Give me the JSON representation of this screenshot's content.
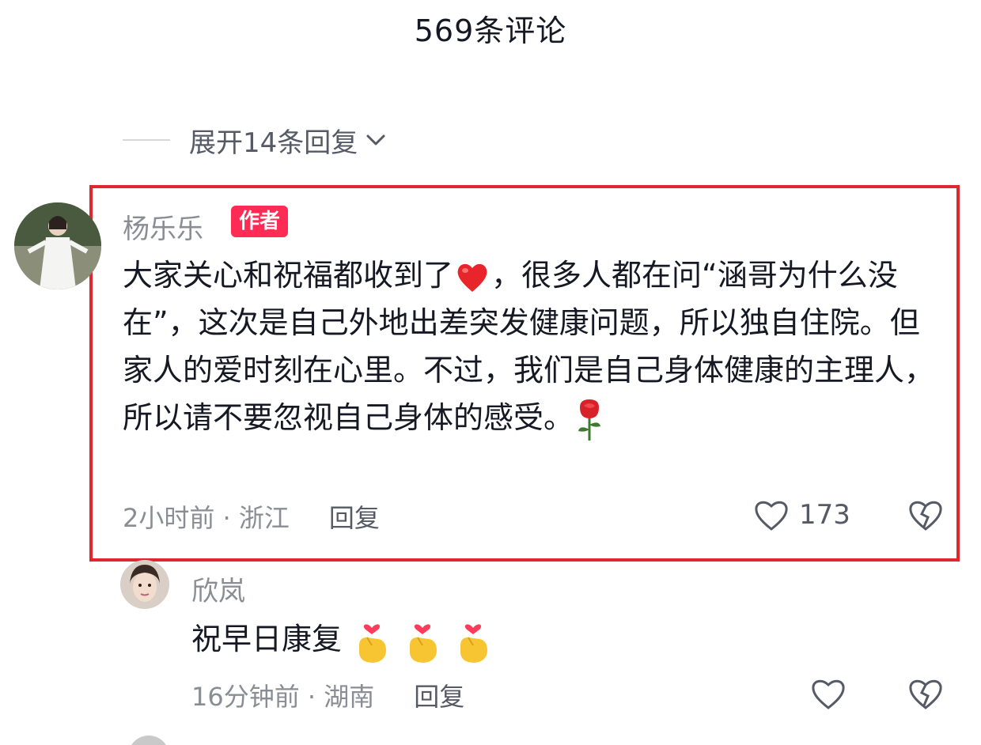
{
  "header": {
    "title": "569条评论"
  },
  "expand": {
    "label": "展开14条回复"
  },
  "comment1": {
    "username": "杨乐乐",
    "badge": "作者",
    "text_part1": "大家关心和祝福都收到了",
    "text_part2": "，很多人都在问“涵哥为什么没在”，这次是自己外地出差突发健康问题，所以独自住院。但家人的爱时刻在心里。不过，我们是自己身体健康的主理人，所以请不要忽视自己身体的感受。",
    "time_location": "2小时前 · 浙江",
    "reply_label": "回复",
    "like_count": "173",
    "icons": [
      "red-heart-icon",
      "rose-icon",
      "heart-outline-icon",
      "broken-heart-icon"
    ]
  },
  "comment2": {
    "username": "欣岚",
    "text": "祝早日康复",
    "time_location": "16分钟前 · 湖南",
    "reply_label": "回复",
    "icons": [
      "finger-heart-icon",
      "heart-outline-icon",
      "broken-heart-icon"
    ]
  },
  "colors": {
    "highlight": "#e0262f",
    "badge": "#fe2c55",
    "meta": "#8a8d94"
  }
}
